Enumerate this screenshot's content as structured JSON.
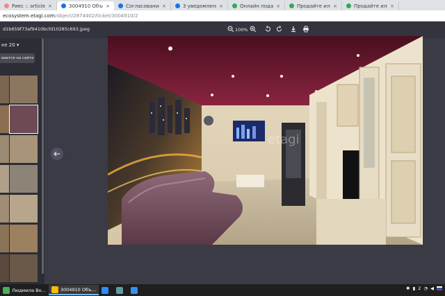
{
  "tabs": [
    {
      "label": "Риес :: articles",
      "color": "#f28b82"
    },
    {
      "label": "3004910 Объект",
      "color": "#1a73e8",
      "active": true
    },
    {
      "label": "Согласование займа В",
      "color": "#1a73e8"
    },
    {
      "label": "3 уведомления",
      "color": "#1a73e8"
    },
    {
      "label": "Онлайн подача заявк",
      "color": "#34a853"
    },
    {
      "label": "Продайте или сдайте",
      "color": "#34a853"
    },
    {
      "label": "Продайте или сдайте",
      "color": "#34a853"
    }
  ],
  "address": {
    "host": "ecosystem.etagi.com",
    "path": "/object/2874402/ticket/3004910/2"
  },
  "viewer": {
    "filename": "d1b659f73af9410bcfd10285c693.jpeg",
    "zoom": "100%"
  },
  "sidebar": {
    "header": "ке 20",
    "button": "вается на сайте"
  },
  "photo": {
    "watermark": "etagi"
  },
  "taskbar": {
    "items": [
      {
        "label": "Людмила Во...",
        "color": "#4caf50"
      },
      {
        "label": "3004910 Объ...",
        "color": "#fbbc05",
        "open": true
      }
    ],
    "apps": [
      {
        "name": "zoom",
        "color": "#2d8cff"
      },
      {
        "name": "app2",
        "color": "#5f9ea0"
      },
      {
        "name": "app3",
        "color": "#3b8eea"
      }
    ],
    "tray_lang": "2"
  }
}
